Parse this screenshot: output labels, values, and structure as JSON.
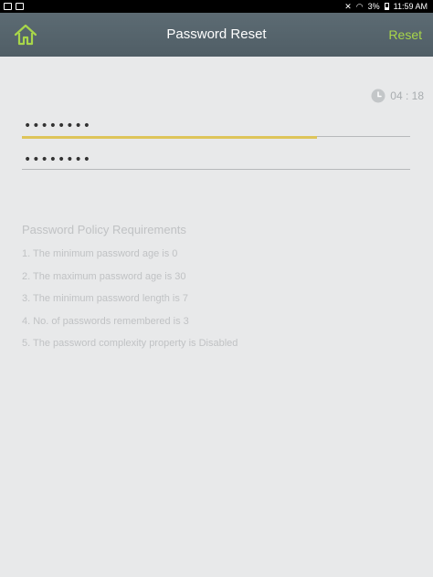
{
  "status_bar": {
    "battery_text": "3%",
    "time": "11:59 AM"
  },
  "toolbar": {
    "title": "Password Reset",
    "reset_label": "Reset",
    "home_icon": "home-icon",
    "accent_color": "#a8d64a"
  },
  "timer": {
    "value": "04 : 18",
    "icon": "clock-icon"
  },
  "form": {
    "new_password_value": "••••••••",
    "confirm_password_value": "••••••••",
    "strength_fraction": 0.76,
    "strength_color": "#dec55a"
  },
  "policy": {
    "title": "Password Policy Requirements",
    "items": [
      "1. The minimum password age is 0",
      "2. The maximum password age is 30",
      "3. The minimum password length is 7",
      "4. No. of passwords remembered is 3",
      "5. The password complexity property is Disabled"
    ]
  }
}
